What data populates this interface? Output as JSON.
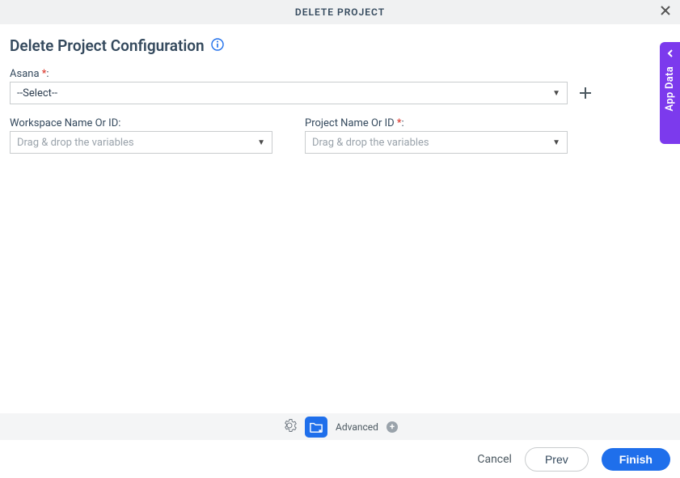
{
  "header": {
    "title": "DELETE PROJECT"
  },
  "page": {
    "title": "Delete Project Configuration"
  },
  "fields": {
    "asana": {
      "label": "Asana ",
      "selected": "--Select--"
    },
    "workspace": {
      "label": "Workspace Name Or ID:",
      "placeholder": "Drag & drop the variables"
    },
    "project": {
      "label": "Project Name Or ID ",
      "placeholder": "Drag & drop the variables"
    }
  },
  "sideTab": {
    "label": "App Data"
  },
  "advanced": {
    "label": "Advanced"
  },
  "footer": {
    "cancel": "Cancel",
    "prev": "Prev",
    "finish": "Finish"
  }
}
